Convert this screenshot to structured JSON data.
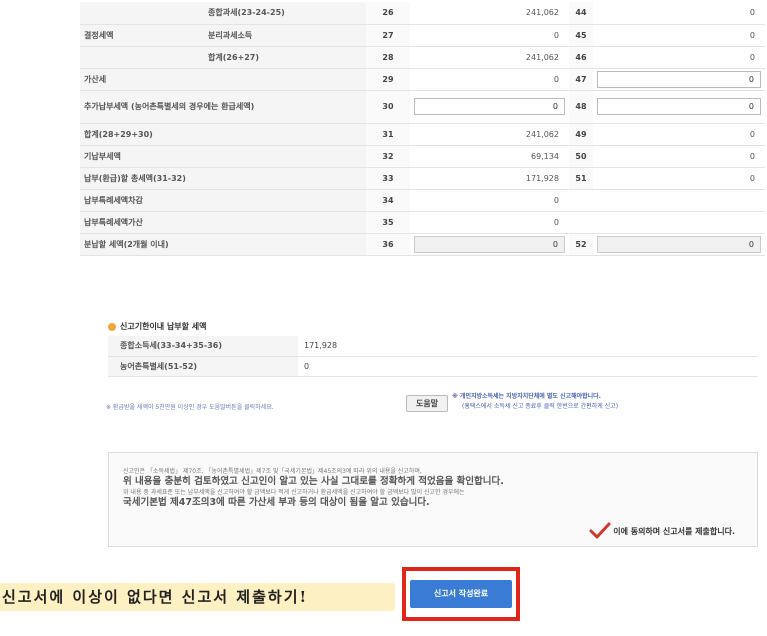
{
  "form": {
    "rows": [
      {
        "group": "",
        "label": "종합과세(23-24-25)",
        "num_a": "26",
        "val_a": "241,062",
        "num_b": "44",
        "val_b": "0"
      },
      {
        "group": "결정세액",
        "label": "분리과세소득",
        "num_a": "27",
        "val_a": "0",
        "num_b": "45",
        "val_b": "0"
      },
      {
        "group": "",
        "label": "합계(26+27)",
        "num_a": "28",
        "val_a": "241,062",
        "num_b": "46",
        "val_b": "0"
      },
      {
        "label": "가산세",
        "num_a": "29",
        "val_a": "0",
        "num_b": "47",
        "val_b": "0"
      },
      {
        "label": "추가납부세액\n(농어촌특별세의 경우에는 환급세액)",
        "num_a": "30",
        "val_a": "0",
        "num_b": "48",
        "val_b": "0"
      },
      {
        "label": "합계(28+29+30)",
        "num_a": "31",
        "val_a": "241,062",
        "num_b": "49",
        "val_b": "0"
      },
      {
        "label": "기납부세액",
        "num_a": "32",
        "val_a": "69,134",
        "num_b": "50",
        "val_b": "0"
      },
      {
        "label": "납부(환급)할 총세액(31-32)",
        "num_a": "33",
        "val_a": "171,928",
        "num_b": "51",
        "val_b": "0"
      },
      {
        "label": "납부특례세액차감",
        "num_a": "34",
        "val_a": "0"
      },
      {
        "label": "납부특례세액가산",
        "num_a": "35",
        "val_a": "0"
      },
      {
        "label": "분납할 세액(2개월 이내)",
        "num_a": "36",
        "val_a": "0",
        "num_b": "52",
        "val_b": "0"
      }
    ]
  },
  "payment_section": {
    "title": "신고기한이내 납부할 세액",
    "rows": [
      {
        "label": "종합소득세(33-34+35-36)",
        "value": "171,928"
      },
      {
        "label": "농어촌특별세(51-52)",
        "value": "0"
      }
    ]
  },
  "notes": {
    "refund_note": "※ 환급받을 세액이 5천만원 이상인 경우 도움말버튼을 클릭하세요.",
    "help_button": "도움말",
    "local_tax_line1": "※ 개인지방소득세는 지방자치단체에 별도 신고해야합니다.",
    "local_tax_line2": "(홈택스에서 소득세 신고 종료후 클릭 한번으로 간편하게 신고)"
  },
  "declaration": {
    "line1": "신고인은 「소득세법」 제70조, 「농어촌특별세법」제7조 및「국세기본법」제45조의3에 따라 위의 내용을 신고하며,",
    "line2": "위 내용을 충분히 검토하였고 신고인이 알고 있는 사실 그대로를 정확하게 적었음을 확인합니다.",
    "line3": "위 내용 중 과세표준 또는 납부세액을 신고하여야 할 금액보다 적게 신고하거나 환급세액을 신고하여야 할 금액보다 많이 신고한 경우에는",
    "line4": "국세기본법 제47조의3에 따른 가산세 부과 등의 대상이 됨을 알고 있습니다.",
    "agree_label": "이에 동의하며 신고서를 제출합니다."
  },
  "footer": {
    "caption": "신고서에 이상이 없다면 신고서 제출하기!",
    "submit_button": "신고서 작성완료"
  },
  "colors": {
    "accent_blue": "#3a7bd5",
    "highlight_red": "#e0251a",
    "caption_bg": "#fdf0c2",
    "bullet_orange": "#f2a33a"
  }
}
